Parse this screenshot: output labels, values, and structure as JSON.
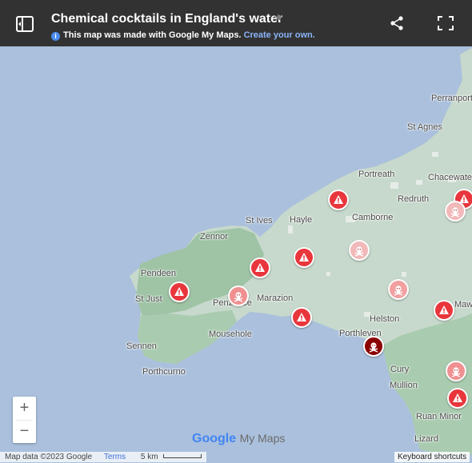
{
  "header": {
    "title": "Chemical cocktails in England's water",
    "notice_text": "This map was made with Google My Maps.",
    "notice_link": "Create your own."
  },
  "places": [
    "Perranport",
    "St Agnes",
    "Portreath",
    "Chacewater",
    "Redruth",
    "Camborne",
    "St Ives",
    "Zennor",
    "Hayle",
    "Pendeen",
    "St Just",
    "Penzance",
    "Marazion",
    "Mousehole",
    "Sennen",
    "Porthcurno",
    "Porthleven",
    "Helston",
    "Cury",
    "Mullion",
    "Ruan Minor",
    "Lizard",
    "Maw"
  ],
  "markers": [
    {
      "type": "warning",
      "color": "#e8363c"
    },
    {
      "type": "warning",
      "color": "#e8363c"
    },
    {
      "type": "skull",
      "color": "#f2b9b9"
    },
    {
      "type": "warning",
      "color": "#e8363c"
    },
    {
      "type": "skull",
      "color": "#f2b9b9"
    },
    {
      "type": "warning",
      "color": "#e8363c"
    },
    {
      "type": "warning",
      "color": "#e8363c"
    },
    {
      "type": "skull",
      "color": "#f09090"
    },
    {
      "type": "warning",
      "color": "#e8363c"
    },
    {
      "type": "skull",
      "color": "#f2a0a0"
    },
    {
      "type": "warning",
      "color": "#e8363c"
    },
    {
      "type": "skull",
      "color": "#8b0000"
    },
    {
      "type": "skull",
      "color": "#f09090"
    },
    {
      "type": "warning",
      "color": "#e8363c"
    }
  ],
  "zoom": {
    "in": "+",
    "out": "−"
  },
  "brand": {
    "google": "Google",
    "mymaps": "My Maps"
  },
  "footer": {
    "data": "Map data ©2023 Google",
    "terms": "Terms",
    "scale": "5 km"
  },
  "keyboard": "Keyboard shortcuts"
}
